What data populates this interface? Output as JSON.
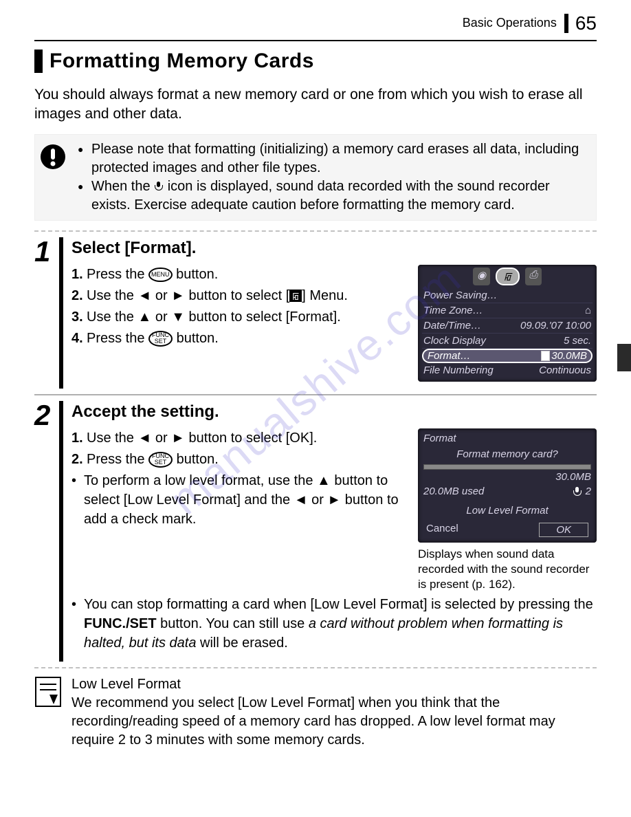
{
  "header": {
    "section": "Basic Operations",
    "page": "65"
  },
  "title": "Formatting Memory Cards",
  "intro": "You should always format a new memory card or one from which you wish to erase all images and other data.",
  "note": {
    "b1": "Please note that formatting (initializing) a memory card erases all data, including protected images and other file types.",
    "b2a": "When the ",
    "b2b": " icon is displayed, sound data recorded with the sound recorder exists. Exercise adequate caution before formatting the memory card."
  },
  "step1": {
    "num": "1",
    "title": "Select [Format].",
    "l1a": "1.",
    "l1b": "Press the ",
    "l1c": "MENU",
    "l1d": " button.",
    "l2a": "2.",
    "l2b": "Use the ",
    "l2c": " or ",
    "l2d": " button to select [",
    "l2e": "] Menu.",
    "l3a": "3.",
    "l3b": "Use the ",
    "l3c": " or ",
    "l3d": " button to select [Format].",
    "l4a": "4.",
    "l4b": "Press the ",
    "l4c": "FUNC SET",
    "l4d": " button."
  },
  "lcd1": {
    "r1a": "Power Saving…",
    "r2a": "Time Zone…",
    "r2b": "⌂",
    "r3a": "Date/Time…",
    "r3b": "09.09.'07 10:00",
    "r4a": "Clock Display",
    "r4b": "5 sec.",
    "r5a": "Format…",
    "r5b": "30.0MB",
    "r6a": "File Numbering",
    "r6b": "Continuous"
  },
  "step2": {
    "num": "2",
    "title": "Accept the setting.",
    "l1a": "1.",
    "l1b": "Use the ",
    "l1c": " or ",
    "l1d": " button to select [OK].",
    "l2a": "2.",
    "l2b": "Press the ",
    "l2c": "FUNC SET",
    "l2d": " button.",
    "b1a": "To perform a low level format, use the ",
    "b1b": " button to select [Low Level Format] and the ",
    "b1c": " or ",
    "b1d": " button to add a check mark.",
    "b2a": "You can stop formatting a card when [Low Level Format] is selected by pressing the ",
    "b2b": "FUNC./SET",
    "b2c": " button. You can still use ",
    "b2d": "a card without problem when formatting is halted, but its data",
    "b2e": " will be erased."
  },
  "lcd2": {
    "title": "Format",
    "q": "Format memory card?",
    "cap": "30.0MB",
    "used": "20.0MB used",
    "mic": "2",
    "opt": "Low Level Format",
    "cancel": "Cancel",
    "ok": "OK"
  },
  "caption2": "Displays when sound data recorded with the sound recorder is present (p. 162).",
  "tip": {
    "title": "Low Level Format",
    "body": "We recommend you select [Low Level Format] when you think that the recording/reading speed of a memory card has dropped. A low level format may require 2 to 3 minutes with some memory cards."
  },
  "watermark": "manualshive.com"
}
